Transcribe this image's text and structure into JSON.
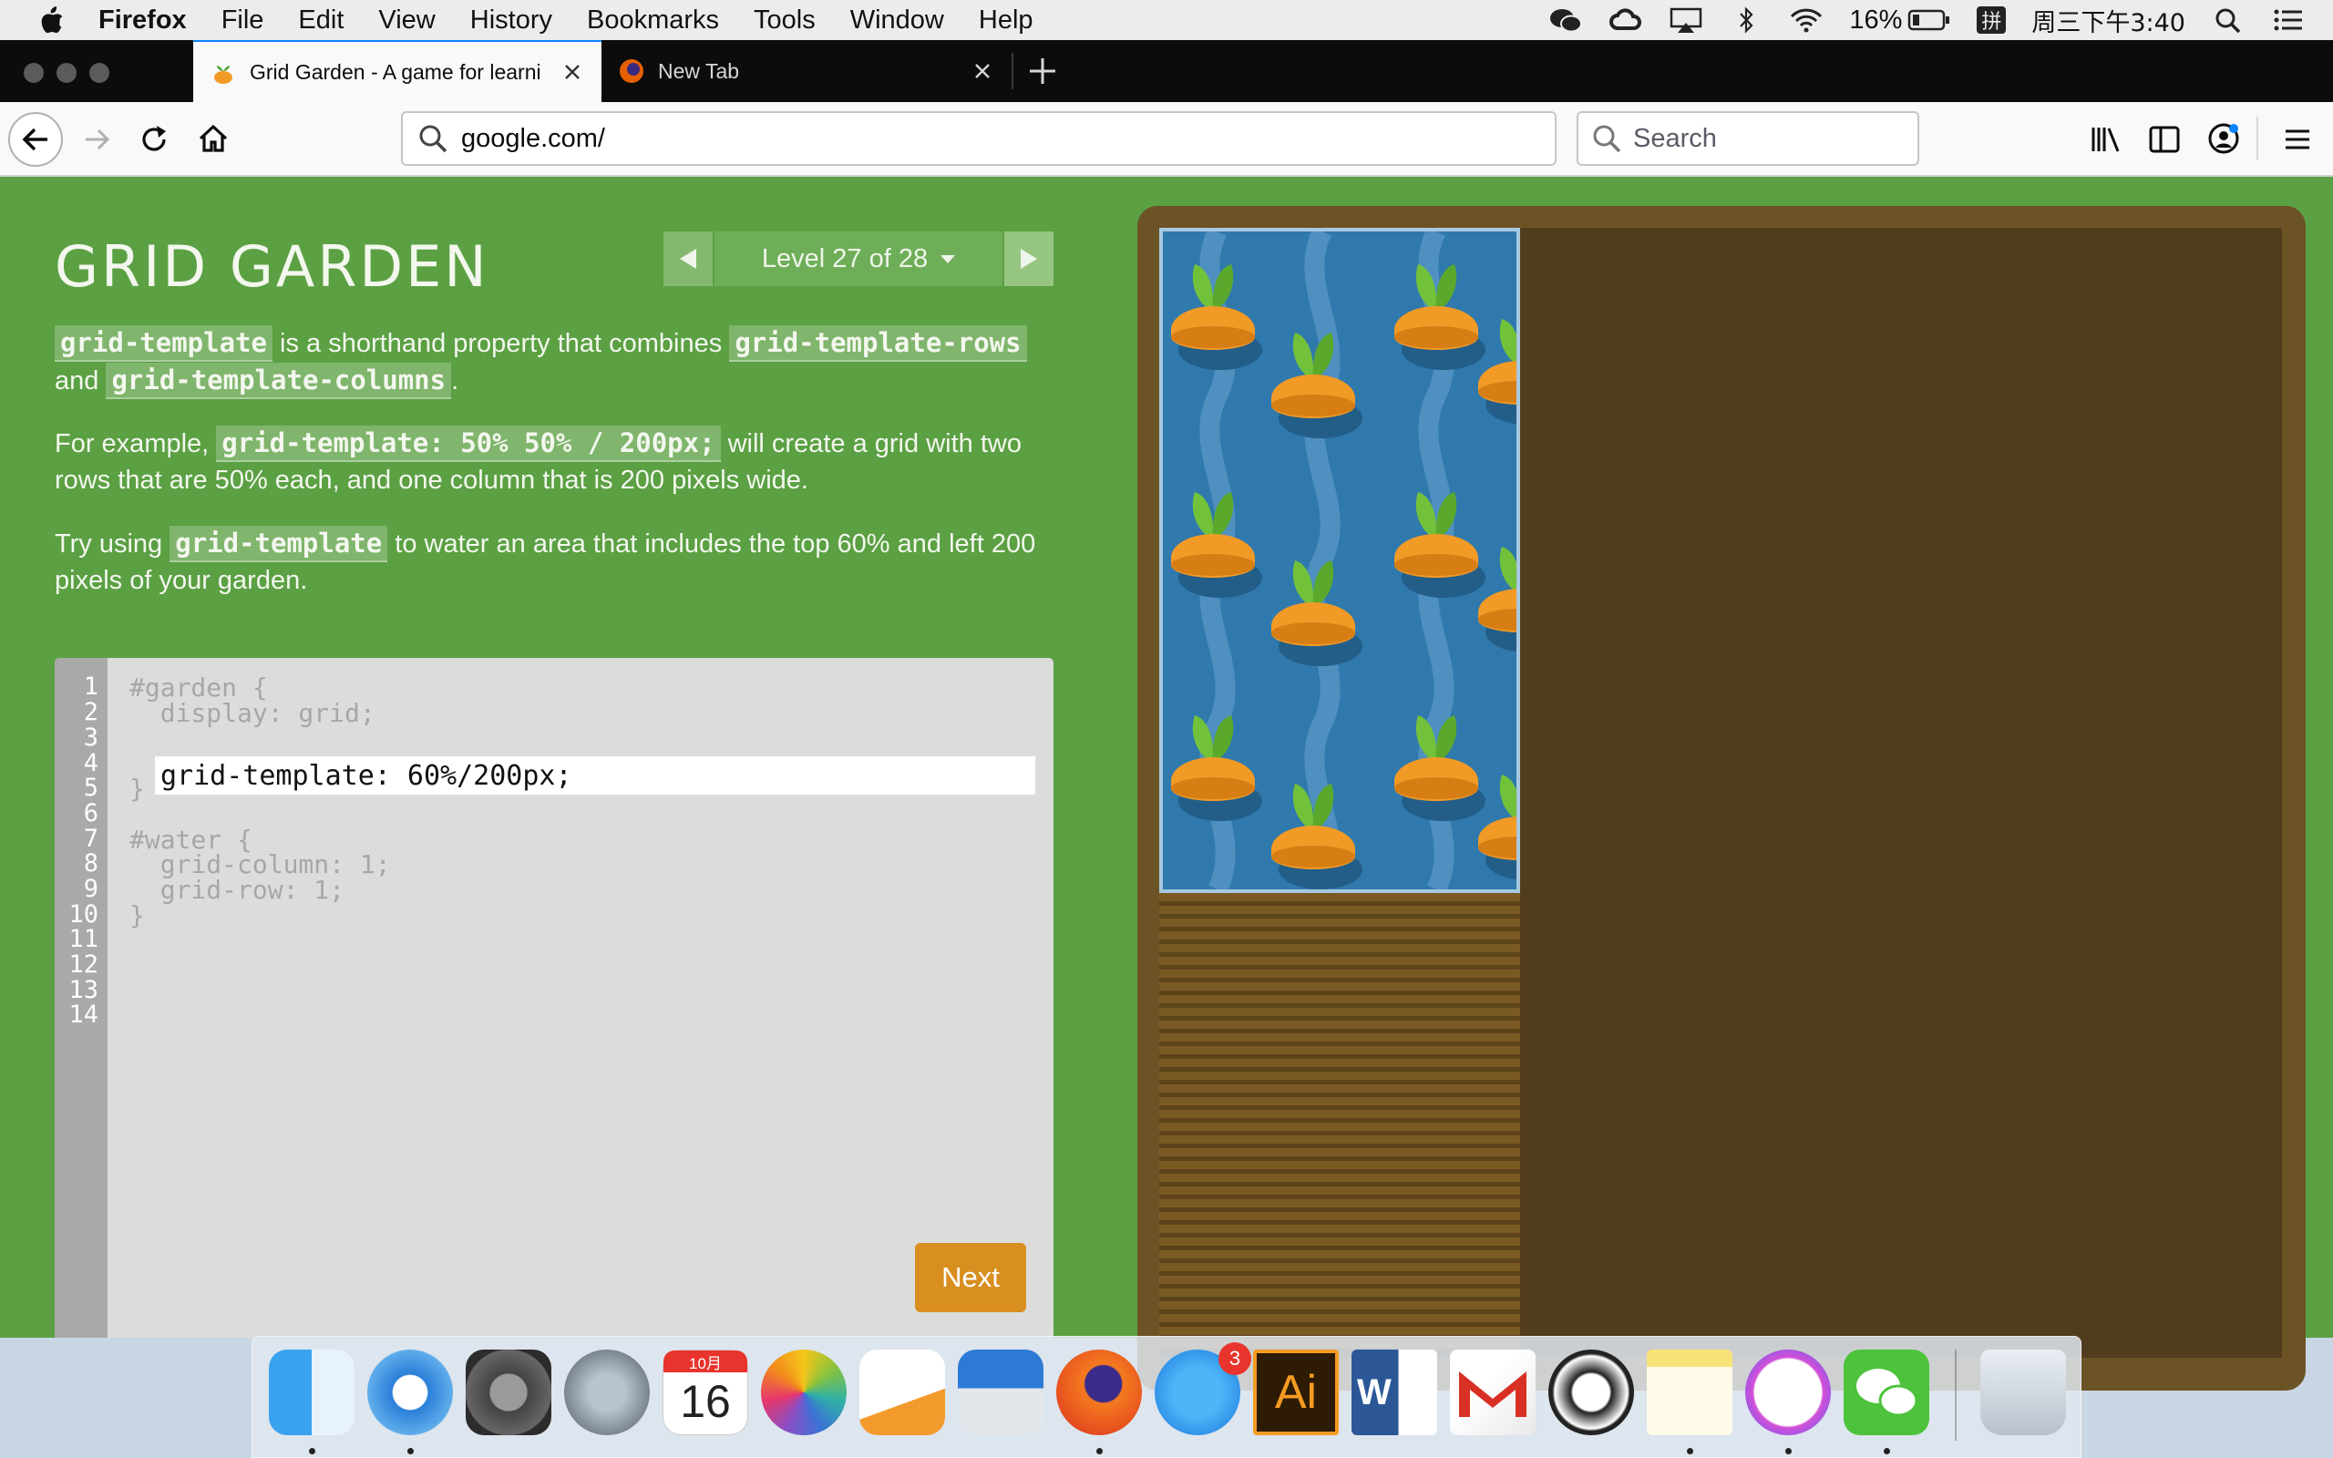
{
  "menubar": {
    "app_name": "Firefox",
    "items": [
      "File",
      "Edit",
      "View",
      "History",
      "Bookmarks",
      "Tools",
      "Window",
      "Help"
    ],
    "battery": "16%",
    "clock": "周三下午3:40",
    "input_method": "拼"
  },
  "tabs": [
    {
      "title": "Grid Garden - A game for learni",
      "active": true
    },
    {
      "title": "New Tab",
      "active": false
    }
  ],
  "navbar": {
    "url": "google.com/",
    "search_placeholder": "Search"
  },
  "game": {
    "title": "GRID GARDEN",
    "level_label": "Level 27 of 28",
    "p1": {
      "code1": "grid-template",
      "text1": " is a shorthand property that combines ",
      "code2": "grid-template-rows",
      "text2": " and ",
      "code3": "grid-template-columns",
      "text3": "."
    },
    "p2": {
      "text1": "For example, ",
      "code1": "grid-template: 50% 50% / 200px;",
      "text2": " will create a grid with two rows that are 50% each, and one column that is 200 pixels wide."
    },
    "p3": {
      "text1": "Try using ",
      "code1": "grid-template",
      "text2": " to water an area that includes the top 60% and left 200 pixels of your garden."
    },
    "line_numbers": [
      "1",
      "2",
      "3",
      "4",
      "5",
      "6",
      "7",
      "8",
      "9",
      "10",
      "11",
      "12",
      "13",
      "14"
    ],
    "code_lines": {
      "l1": "#garden {",
      "l2": "  display: grid;",
      "l5": "}",
      "l7": "#water {",
      "l8": "  grid-column: 1;",
      "l9": "  grid-row: 1;",
      "l10": "}"
    },
    "input_value": "grid-template: 60%/200px;",
    "next_label": "Next"
  },
  "dock": {
    "calendar_month": "10月",
    "calendar_day": "16",
    "appstore_badge": "3",
    "illustrator_label": "Ai",
    "word_label": "W",
    "apps": [
      "finder",
      "safari",
      "system-preferences",
      "launchpad",
      "calendar",
      "photos",
      "pages",
      "keynote",
      "firefox",
      "app-store",
      "illustrator",
      "word",
      "gmail",
      "lemon",
      "notes",
      "itunes",
      "wechat",
      "trash"
    ]
  },
  "colors": {
    "page_green": "#5ba043",
    "water_blue": "#2f79ad",
    "soil_brown": "#523c1e",
    "next_orange": "#d88f1f",
    "carrot_orange": "#f29a26",
    "leaf_green": "#72c13b"
  }
}
